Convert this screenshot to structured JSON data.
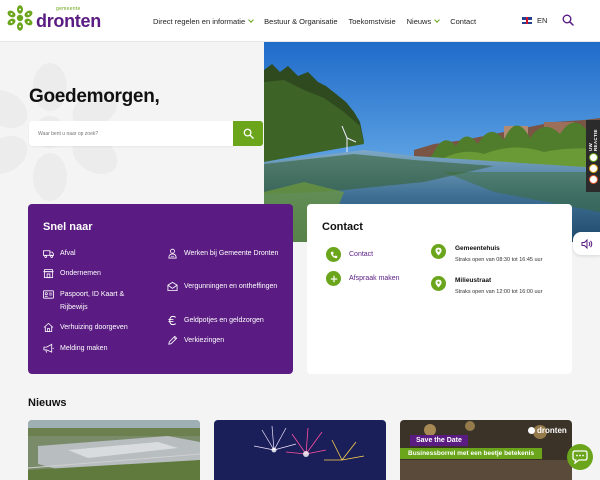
{
  "header": {
    "logo_small": "gemeente",
    "logo_big": "dronten",
    "nav": [
      {
        "label": "Direct regelen en informatie",
        "dropdown": true
      },
      {
        "label": "Bestuur & Organisatie",
        "dropdown": false
      },
      {
        "label": "Toekomstvisie",
        "dropdown": false
      },
      {
        "label": "Nieuws",
        "dropdown": true
      },
      {
        "label": "Contact",
        "dropdown": false
      }
    ],
    "language": "EN"
  },
  "hero": {
    "greeting": "Goedemorgen,",
    "search_placeholder": "Waar bent u naar op zoek?"
  },
  "feedback_tab": {
    "label": "UW REACTIE"
  },
  "snel_naar": {
    "title": "Snel naar",
    "left": [
      {
        "label": "Afval",
        "icon": "truck-icon"
      },
      {
        "label": "Ondernemen",
        "icon": "shop-icon"
      },
      {
        "label": "Paspoort, ID Kaart & Rijbewijs",
        "icon": "id-card-icon"
      },
      {
        "label": "Verhuizing doorgeven",
        "icon": "house-icon"
      },
      {
        "label": "Melding maken",
        "icon": "megaphone-icon"
      }
    ],
    "right": [
      {
        "label": "Werken bij Gemeente Dronten",
        "icon": "person-icon"
      },
      {
        "label": "Vergunningen en ontheffingen",
        "icon": "envelope-icon"
      },
      {
        "label": "Geldpotjes en geldzorgen",
        "icon": "euro-icon"
      },
      {
        "label": "Verkiezingen",
        "icon": "pencil-icon"
      }
    ]
  },
  "contact": {
    "title": "Contact",
    "links": [
      {
        "label": "Contact",
        "icon": "phone-icon"
      },
      {
        "label": "Afspraak maken",
        "icon": "plus-icon"
      }
    ],
    "locations": [
      {
        "name": "Gemeentehuis",
        "hours": "Straks open van 08:30 tot 16:45 uur"
      },
      {
        "name": "Milieustraat",
        "hours": "Straks open van 12:00 tot 16:00 uur"
      }
    ]
  },
  "news": {
    "title": "Nieuws",
    "card3": {
      "brand": "dronten",
      "banner_title": "Save the Date",
      "banner_sub": "Businessborrel met een beetje betekenis"
    }
  },
  "colors": {
    "purple": "#5a1c82",
    "green": "#6aa51b",
    "background": "#f4f4f4"
  }
}
